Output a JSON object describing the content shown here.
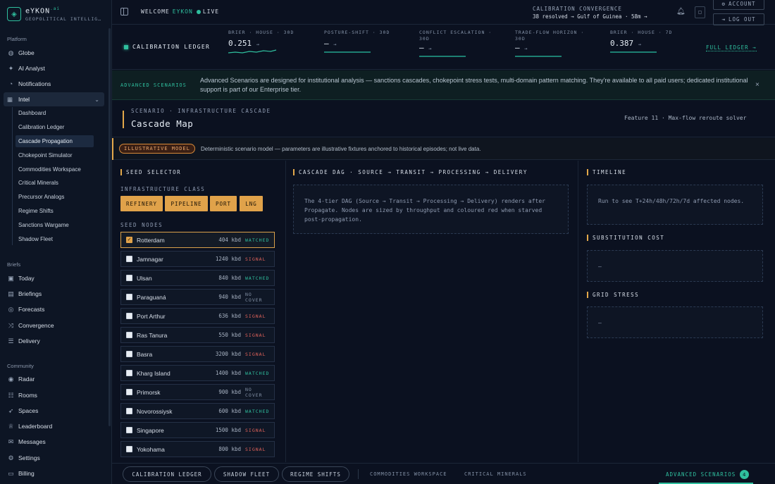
{
  "brand": {
    "name": "eYKON",
    "sup": ".ai",
    "subtitle": "GEOPOLITICAL INTELLIG…"
  },
  "sidebar": {
    "platform_label": "Platform",
    "platform": [
      {
        "label": "Globe",
        "icon": "globe-icon"
      },
      {
        "label": "AI Analyst",
        "icon": "sparkle-icon"
      },
      {
        "label": "Notifications",
        "icon": "bell-icon"
      }
    ],
    "intel_label": "Intel",
    "intel_items": [
      "Dashboard",
      "Calibration Ledger",
      "Cascade Propagation",
      "Chokepoint Simulator",
      "Commodities Workspace",
      "Critical Minerals",
      "Precursor Analogs",
      "Regime Shifts",
      "Sanctions Wargame",
      "Shadow Fleet"
    ],
    "briefs_label": "Briefs",
    "briefs": [
      {
        "label": "Today",
        "icon": "calendar-icon"
      },
      {
        "label": "Briefings",
        "icon": "document-icon"
      },
      {
        "label": "Forecasts",
        "icon": "target-icon"
      },
      {
        "label": "Convergence",
        "icon": "merge-icon"
      },
      {
        "label": "Delivery",
        "icon": "sliders-icon"
      }
    ],
    "community_label": "Community",
    "community": [
      {
        "label": "Radar",
        "icon": "radar-icon"
      },
      {
        "label": "Rooms",
        "icon": "users-icon"
      },
      {
        "label": "Spaces",
        "icon": "rocket-icon"
      },
      {
        "label": "Leaderboard",
        "icon": "trophy-icon"
      },
      {
        "label": "Messages",
        "icon": "mail-icon"
      },
      {
        "label": "Settings",
        "icon": "gear-icon"
      },
      {
        "label": "Billing",
        "icon": "card-icon"
      }
    ]
  },
  "topbar": {
    "welcome": "WELCOME",
    "user": "EYKON",
    "live": "LIVE",
    "cal_label": "CALIBRATION  CONVERGENCE",
    "cal_value": "38 resolved → Gulf of Guinea · 58m →",
    "account": "ACCOUNT",
    "logout": "LOG OUT"
  },
  "ledger": {
    "title": "CALIBRATION LEDGER",
    "full": "FULL LEDGER →",
    "metrics": [
      {
        "label": "BRIER · HOUSE · 30D",
        "value": "0.251",
        "arrow": "→"
      },
      {
        "label": "POSTURE-SHIFT · 30D",
        "value": "—",
        "arrow": "→"
      },
      {
        "label": "CONFLICT ESCALATION · 30D",
        "value": "—",
        "arrow": "→"
      },
      {
        "label": "TRADE-FLOW HORIZON · 30D",
        "value": "—",
        "arrow": "→"
      },
      {
        "label": "BRIER · HOUSE · 7D",
        "value": "0.387",
        "arrow": "→"
      }
    ]
  },
  "banner": {
    "tag": "ADVANCED SCENARIOS",
    "text": "Advanced Scenarios are designed for institutional analysis — sanctions cascades, chokepoint stress tests, multi-domain pattern matching. They're available to all paid users; dedicated institutional support is part of our Enterprise tier.",
    "close": "×"
  },
  "scenario": {
    "kicker": "SCENARIO · INFRASTRUCTURE CASCADE",
    "title": "Cascade Map",
    "feature": "Feature 11 · Max-flow reroute solver"
  },
  "illustrative": {
    "pill": "ILLUSTRATIVE MODEL",
    "text": "Deterministic scenario model — parameters are illustrative fixtures anchored to historical episodes; not live data."
  },
  "seed": {
    "title": "SEED SELECTOR",
    "class_label": "INFRASTRUCTURE CLASS",
    "classes": [
      "REFINERY",
      "PIPELINE",
      "PORT",
      "LNG"
    ],
    "nodes_label": "SEED NODES",
    "nodes": [
      {
        "name": "Rotterdam",
        "kbd": "404 kbd",
        "status": "WATCHED",
        "checked": true
      },
      {
        "name": "Jamnagar",
        "kbd": "1240 kbd",
        "status": "SIGNAL",
        "checked": false
      },
      {
        "name": "Ulsan",
        "kbd": "840 kbd",
        "status": "WATCHED",
        "checked": false
      },
      {
        "name": "Paraguaná",
        "kbd": "940 kbd",
        "status": "NO COVER",
        "checked": false
      },
      {
        "name": "Port Arthur",
        "kbd": "636 kbd",
        "status": "SIGNAL",
        "checked": false
      },
      {
        "name": "Ras Tanura",
        "kbd": "550 kbd",
        "status": "SIGNAL",
        "checked": false
      },
      {
        "name": "Basra",
        "kbd": "3200 kbd",
        "status": "SIGNAL",
        "checked": false
      },
      {
        "name": "Kharg Island",
        "kbd": "1400 kbd",
        "status": "WATCHED",
        "checked": false
      },
      {
        "name": "Primorsk",
        "kbd": "900 kbd",
        "status": "NO COVER",
        "checked": false
      },
      {
        "name": "Novorossiysk",
        "kbd": "600 kbd",
        "status": "WATCHED",
        "checked": false
      },
      {
        "name": "Singapore",
        "kbd": "1500 kbd",
        "status": "SIGNAL",
        "checked": false
      },
      {
        "name": "Yokohama",
        "kbd": "800 kbd",
        "status": "SIGNAL",
        "checked": false
      }
    ]
  },
  "dag": {
    "title": "CASCADE DAG · SOURCE → TRANSIT → PROCESSING → DELIVERY",
    "text": "The 4-tier DAG (Source → Transit → Processing → Delivery) renders after Propagate. Nodes are sized by throughput and coloured red when starved post-propagation."
  },
  "right": {
    "timeline_title": "TIMELINE",
    "timeline_text": "Run to see T+24h/48h/72h/7d affected nodes.",
    "subst_title": "SUBSTITUTION COST",
    "subst_value": "—",
    "grid_title": "GRID STRESS",
    "grid_value": "—"
  },
  "bottom": {
    "tabs": [
      "CALIBRATION LEDGER",
      "SHADOW FLEET",
      "REGIME SHIFTS"
    ],
    "links": [
      "COMMODITIES WORKSPACE",
      "CRITICAL MINERALS"
    ],
    "advanced": "ADVANCED SCENARIOS",
    "badge": "4"
  },
  "colors": {
    "accent": "#2fbf9e",
    "amber": "#e0a24a",
    "signal": "#e0625a"
  }
}
